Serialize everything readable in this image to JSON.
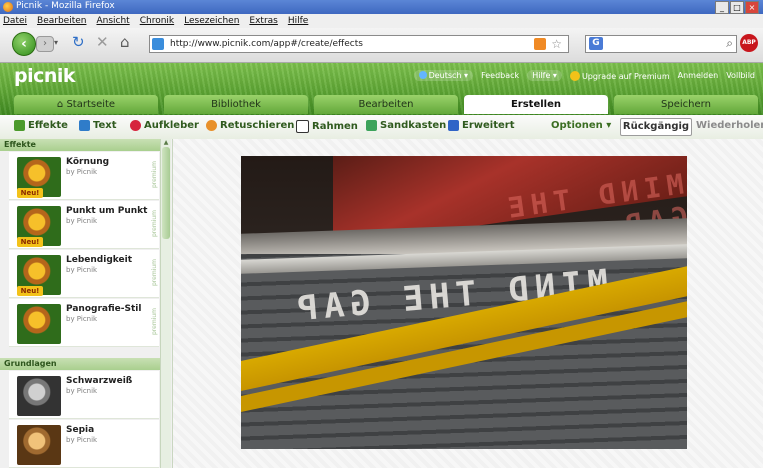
{
  "window": {
    "title": "Picnik - Mozilla Firefox",
    "controls": [
      "_",
      "□",
      "×"
    ]
  },
  "menubar": [
    "Datei",
    "Bearbeiten",
    "Ansicht",
    "Chronik",
    "Lesezeichen",
    "Extras",
    "Hilfe"
  ],
  "nav": {
    "url": "http://www.picnik.com/app#/create/effects",
    "search_engine": "G",
    "search_value": ""
  },
  "picnik": {
    "logo": "picnik",
    "header_links": {
      "language": "Deutsch",
      "feedback": "Feedback",
      "help": "Hilfe",
      "upgrade": "Upgrade auf Premium",
      "signin": "Anmelden",
      "fullscreen": "Vollbild"
    },
    "tabs": [
      "Startseite",
      "Bibliothek",
      "Bearbeiten",
      "Erstellen",
      "Speichern"
    ],
    "active_tab": "Erstellen",
    "tools": [
      "Effekte",
      "Text",
      "Aufkleber",
      "Retuschieren",
      "Rahmen",
      "Sandkasten",
      "Erweitert"
    ],
    "options": "Optionen",
    "undo": "Rückgängig",
    "redo": "Wiederholen"
  },
  "sidebar": {
    "section_effects": "Effekte",
    "section_basics": "Grundlagen",
    "premium_label": "premium",
    "items": [
      {
        "name": "Körnung",
        "by": "by Picnik",
        "badge": "Neu!"
      },
      {
        "name": "Punkt um Punkt",
        "by": "by Picnik",
        "badge": "Neu!"
      },
      {
        "name": "Lebendigkeit",
        "by": "by Picnik",
        "badge": "Neu!"
      },
      {
        "name": "Panografie-Stil",
        "by": "by Picnik",
        "badge": ""
      },
      {
        "name": "Schwarzweiß",
        "by": "by Picnik",
        "badge": ""
      },
      {
        "name": "Sepia",
        "by": "by Picnik",
        "badge": ""
      }
    ]
  },
  "canvas": {
    "photo_text_platform": "MIND THE GAP",
    "photo_text_train": "MIND THE GAP"
  },
  "colors": {
    "picnik_green": "#5ea634",
    "title_blue": "#3e68c0"
  }
}
